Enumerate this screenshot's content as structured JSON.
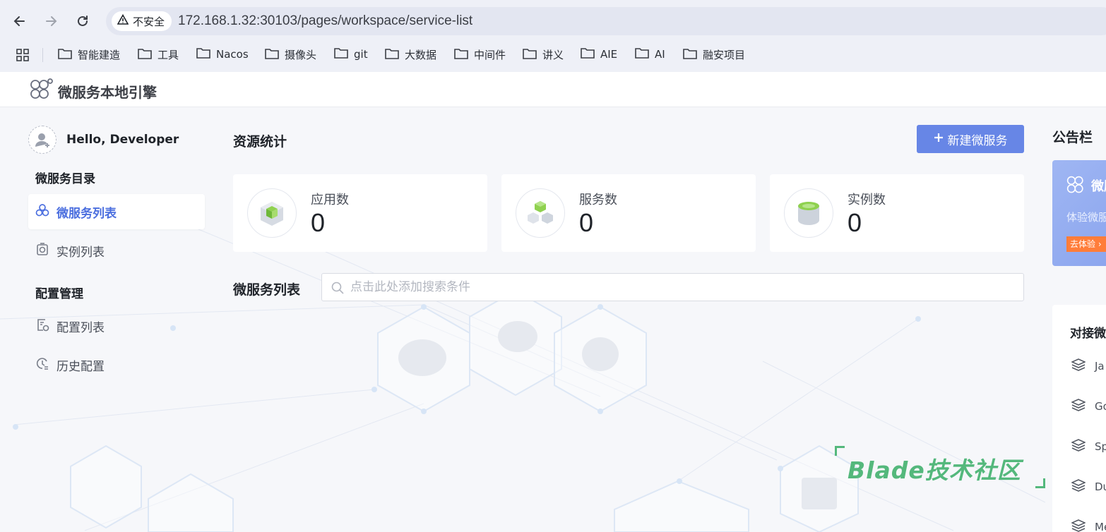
{
  "browser": {
    "security_label": "不安全",
    "url": "172.168.1.32:30103/pages/workspace/service-list",
    "bookmarks": [
      "智能建造",
      "工具",
      "Nacos",
      "摄像头",
      "git",
      "大数据",
      "中间件",
      "讲义",
      "AIE",
      "AI",
      "融安项目"
    ]
  },
  "app": {
    "title": "微服务本地引擎"
  },
  "sidebar": {
    "greeting": "Hello, Developer",
    "section1": "微服务目录",
    "items1": [
      {
        "label": "微服务列表",
        "icon": "hexagon-cluster-icon",
        "active": true
      },
      {
        "label": "实例列表",
        "icon": "camera-box-icon",
        "active": false
      }
    ],
    "section2": "配置管理",
    "items2": [
      {
        "label": "配置列表",
        "icon": "config-list-icon"
      },
      {
        "label": "历史配置",
        "icon": "history-clock-icon"
      }
    ]
  },
  "main": {
    "stats_title": "资源统计",
    "new_button": "新建微服务",
    "stats": [
      {
        "label": "应用数",
        "value": "0",
        "icon": "app-cube-icon"
      },
      {
        "label": "服务数",
        "value": "0",
        "icon": "service-cubes-icon"
      },
      {
        "label": "实例数",
        "value": "0",
        "icon": "instance-cylinder-icon"
      }
    ],
    "list_title": "微服务列表",
    "search_placeholder": "点击此处添加搜索条件"
  },
  "right": {
    "notice_title": "公告栏",
    "banner_title": "微服",
    "banner_sub": "体验微服",
    "banner_button": "去体验",
    "docs_title": "对接微",
    "docs": [
      "Ja",
      "Go",
      "Sp",
      "Du",
      "Me"
    ]
  },
  "watermark": "Blade技术社区",
  "colors": {
    "accent": "#4c6fdf",
    "button": "#6786e6",
    "watermark": "#54b87c"
  }
}
